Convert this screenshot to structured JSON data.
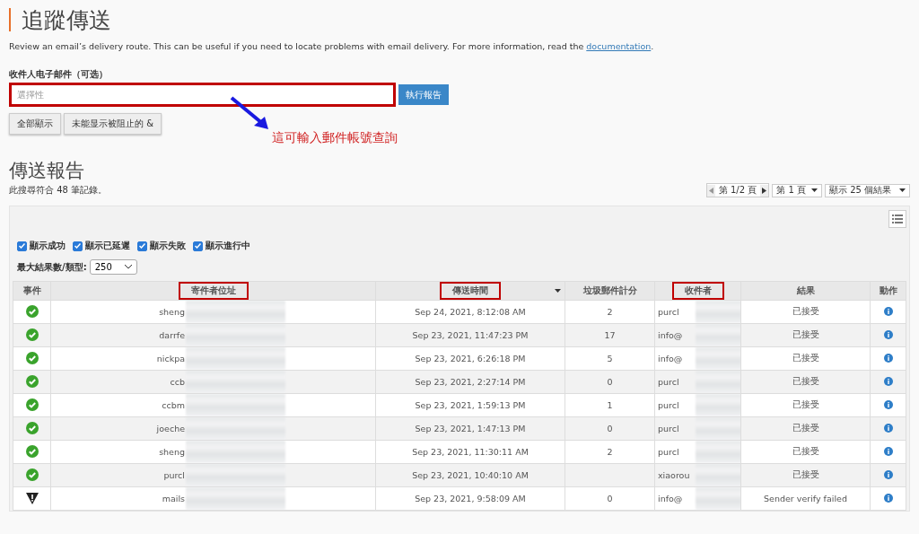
{
  "title": "追蹤傳送",
  "description": {
    "text": "Review an email’s delivery route. This can be useful if you need to locate problems with email delivery. For more information, read the ",
    "link": "documentation",
    "end": "."
  },
  "recipient_field": {
    "label": "收件人电子邮件（可选）",
    "placeholder": "選擇性",
    "highlighted": true
  },
  "run_button": "執行報告",
  "filter_buttons": [
    "全部顯示",
    "未能显示被阻止的 &"
  ],
  "annotation": "這可輸入郵件帳號查詢",
  "report": {
    "title": "傳送報告",
    "count": "此搜尋符合 48 筆記錄。",
    "pager": {
      "page": "第 1/2 頁",
      "page_select": "第 1 頁",
      "size_select": "顯示 25 個結果"
    },
    "filters": [
      {
        "label": "顯示成功",
        "checked": true
      },
      {
        "label": "顯示已延遲",
        "checked": true
      },
      {
        "label": "顯示失敗",
        "checked": true
      },
      {
        "label": "顯示進行中",
        "checked": true
      }
    ],
    "max_label": "最大結果數/類型:",
    "max_value": "250",
    "columns": [
      {
        "label": "事件",
        "highlighted": false,
        "sorted": false
      },
      {
        "label": "寄件者位址",
        "highlighted": true,
        "sorted": false
      },
      {
        "label": "傳送時間",
        "highlighted": true,
        "sorted": true
      },
      {
        "label": "垃圾郵件計分",
        "highlighted": false,
        "sorted": false
      },
      {
        "label": "收件者",
        "highlighted": true,
        "sorted": false
      },
      {
        "label": "結果",
        "highlighted": false,
        "sorted": false
      },
      {
        "label": "動作",
        "highlighted": false,
        "sorted": false
      }
    ],
    "rows": [
      {
        "kind": "success",
        "sender": "sheng",
        "time": "Sep 24, 2021, 8:12:08 AM",
        "spam": "2",
        "recipient": "purcl",
        "result": "已接受"
      },
      {
        "kind": "success",
        "sender": "darrfe",
        "time": "Sep 23, 2021, 11:47:23 PM",
        "spam": "17",
        "recipient": "info@",
        "result": "已接受"
      },
      {
        "kind": "success",
        "sender": "nickpa",
        "time": "Sep 23, 2021, 6:26:18 PM",
        "spam": "5",
        "recipient": "info@",
        "result": "已接受"
      },
      {
        "kind": "success",
        "sender": "ccb",
        "time": "Sep 23, 2021, 2:27:14 PM",
        "spam": "0",
        "recipient": "purcl",
        "result": "已接受"
      },
      {
        "kind": "success",
        "sender": "ccbm",
        "time": "Sep 23, 2021, 1:59:13 PM",
        "spam": "1",
        "recipient": "purcl",
        "result": "已接受"
      },
      {
        "kind": "success",
        "sender": "joeche",
        "time": "Sep 23, 2021, 1:47:13 PM",
        "spam": "0",
        "recipient": "purcl",
        "result": "已接受"
      },
      {
        "kind": "success",
        "sender": "sheng",
        "time": "Sep 23, 2021, 11:30:11 AM",
        "spam": "2",
        "recipient": "purcl",
        "result": "已接受"
      },
      {
        "kind": "success",
        "sender": "purcl",
        "time": "Sep 23, 2021, 10:40:10 AM",
        "recipient": "xiaorou",
        "result": "已接受"
      },
      {
        "kind": "warning",
        "sender": "mails",
        "time": "Sep 23, 2021, 9:58:09 AM",
        "spam": "0",
        "recipient": "info@",
        "result": "Sender verify failed"
      }
    ]
  }
}
